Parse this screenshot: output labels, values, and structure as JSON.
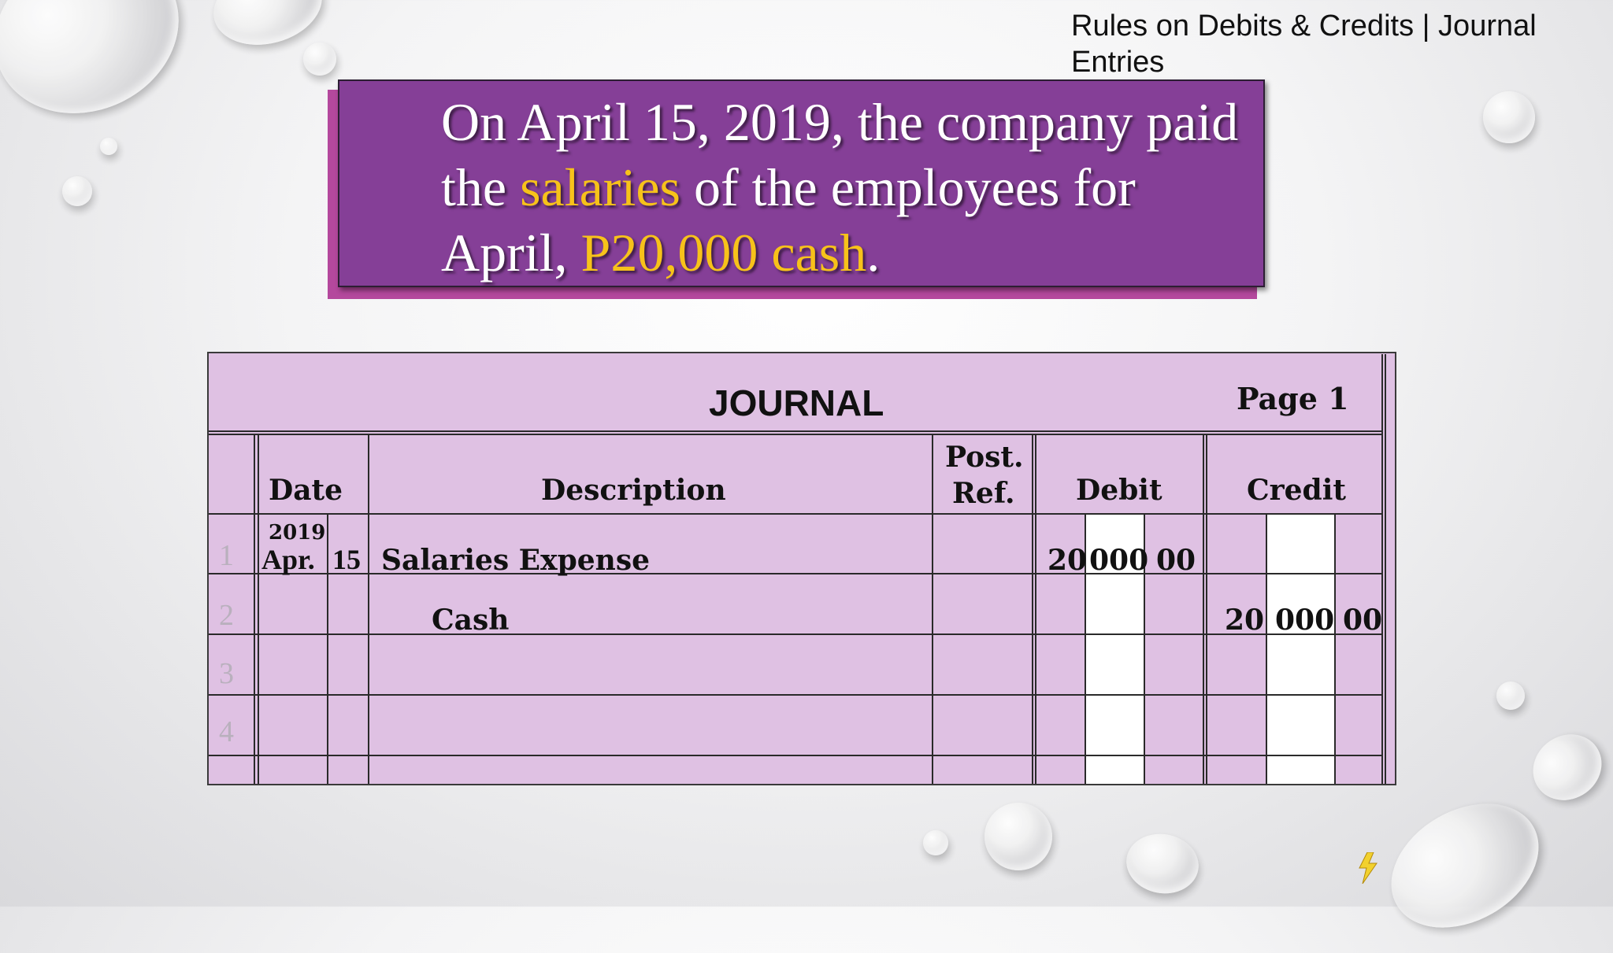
{
  "header": {
    "topic": "Rules on Debits & Credits | Journal Entries"
  },
  "statement": {
    "part1": "On April 15, 2019, the company paid the ",
    "highlight1": "salaries",
    "part2": " of the employees for April, ",
    "highlight2": "P20,000 cash",
    "part3": "."
  },
  "journal": {
    "title": "JOURNAL",
    "page_label": "Page 1",
    "columns": {
      "date": "Date",
      "description": "Description",
      "post_ref_line1": "Post.",
      "post_ref_line2": "Ref.",
      "debit": "Debit",
      "credit": "Credit"
    },
    "row_numbers": [
      "1",
      "2",
      "3",
      "4"
    ],
    "entries": [
      {
        "year": "2019",
        "month": "Apr.",
        "day": "15",
        "description": "Salaries Expense",
        "debit": [
          "20",
          "000",
          "00"
        ]
      },
      {
        "description": "Cash",
        "credit": [
          "20",
          "000",
          "00"
        ]
      }
    ]
  },
  "colors": {
    "purple_box": "#853f97",
    "purple_shadow": "#b4489d",
    "highlight": "#f7c21a",
    "journal_fill": "#dfc1e3"
  }
}
